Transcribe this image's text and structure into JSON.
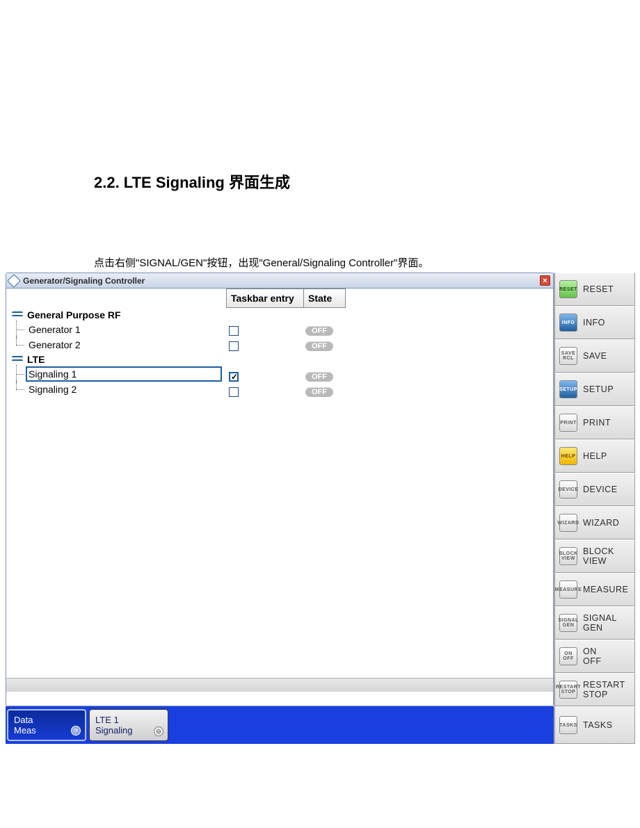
{
  "doc": {
    "heading": "2.2. LTE Signaling 界面生成",
    "paragraph": "点击右侧\"SIGNAL/GEN\"按钮，出现\"General/Signaling Controller\"界面。"
  },
  "app": {
    "title": "Generator/Signaling Controller",
    "columns": {
      "taskbar_entry": "Taskbar entry",
      "state": "State"
    },
    "tree": [
      {
        "name": "General Purpose RF",
        "children": [
          {
            "name": "Generator 1",
            "checked": false,
            "state": "OFF"
          },
          {
            "name": "Generator 2",
            "checked": false,
            "state": "OFF"
          }
        ]
      },
      {
        "name": "LTE",
        "children": [
          {
            "name": "Signaling 1",
            "checked": true,
            "state": "OFF",
            "selected": true
          },
          {
            "name": "Signaling 2",
            "checked": false,
            "state": "OFF"
          }
        ]
      }
    ]
  },
  "softkeys": [
    {
      "icon": "RESET",
      "color": "green",
      "label": "RESET"
    },
    {
      "icon": "INFO",
      "color": "blue",
      "label": "INFO"
    },
    {
      "icon": "SAVE\nRCL",
      "color": "grey",
      "label": "SAVE"
    },
    {
      "icon": "SETUP",
      "color": "blue",
      "label": "SETUP"
    },
    {
      "icon": "PRINT",
      "color": "grey",
      "label": "PRINT"
    },
    {
      "icon": "HELP",
      "color": "yellow",
      "label": "HELP"
    },
    {
      "icon": "DEVICE",
      "color": "grey",
      "label": "DEVICE"
    },
    {
      "icon": "WIZARD",
      "color": "grey",
      "label": "WIZARD"
    },
    {
      "icon": "BLOCK\nVIEW",
      "color": "grey",
      "label": "BLOCK\nVIEW"
    },
    {
      "icon": "MEASURE",
      "color": "grey",
      "label": "MEASURE"
    },
    {
      "icon": "SIGNAL\nGEN",
      "color": "grey",
      "label": "SIGNAL\nGEN"
    },
    {
      "icon": "ON\nOFF",
      "color": "grey",
      "label": "ON\nOFF"
    },
    {
      "icon": "RESTART\nSTOP",
      "color": "grey",
      "label": "RESTART\nSTOP"
    }
  ],
  "tasks_key": {
    "icon": "TASKS",
    "label": "TASKS"
  },
  "taskbar": [
    {
      "line1": "Data",
      "line2": "Meas",
      "active": true,
      "badge": "⟳"
    },
    {
      "line1": "LTE 1",
      "line2": "Signaling",
      "active": false,
      "badge": "⊝"
    }
  ]
}
